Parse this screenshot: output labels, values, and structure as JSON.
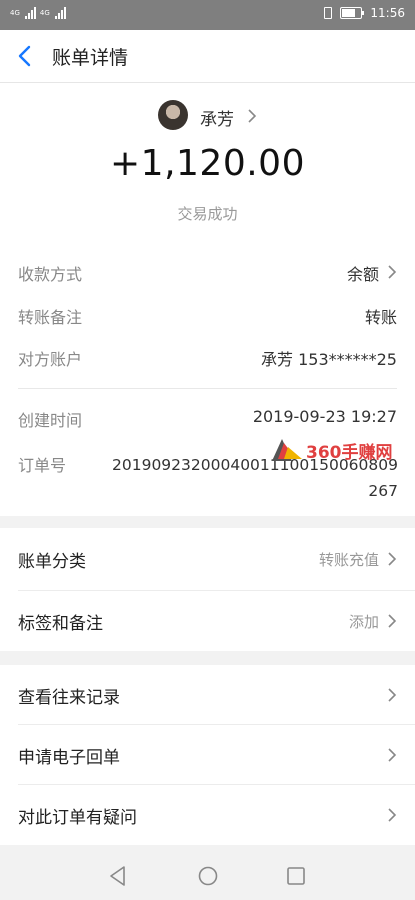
{
  "statusbar": {
    "network_left": "4G",
    "network_right": "4G",
    "time": "11:56",
    "battery_level": 0.8
  },
  "navbar": {
    "title": "账单详情",
    "back_icon": "chevron-left-icon"
  },
  "summary": {
    "name": "承芳",
    "amount": "+1,120.00",
    "status": "交易成功"
  },
  "details": {
    "payment_method_label": "收款方式",
    "payment_method_value": "余额",
    "note_label": "转账备注",
    "note_value": "转账",
    "account_label": "对方账户",
    "account_value": "承芳 153******25",
    "created_label": "创建时间",
    "created_value": "2019-09-23 19:27",
    "order_label": "订单号",
    "order_value": "20190923200040011100150060809267"
  },
  "watermark": {
    "text": "360手赚网"
  },
  "options": {
    "category_label": "账单分类",
    "category_value": "转账充值",
    "tags_label": "标签和备注",
    "tags_value": "添加"
  },
  "actions": {
    "history_label": "查看往来记录",
    "receipt_label": "申请电子回单",
    "question_label": "对此订单有疑问"
  },
  "accent_color": "#1677ff"
}
